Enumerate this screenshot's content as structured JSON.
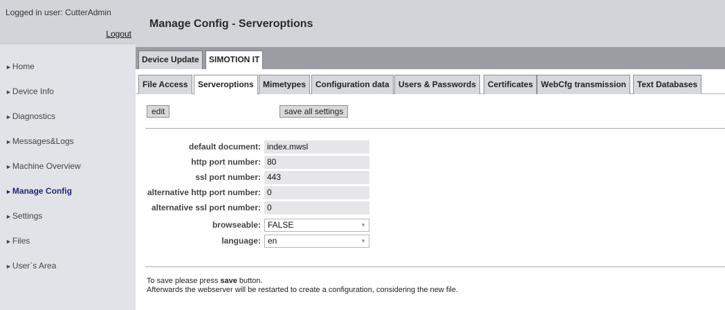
{
  "login": {
    "user_text": "Logged in user: CutterAdmin",
    "logout_label": "Logout"
  },
  "nav": {
    "arrow": "►",
    "items": [
      {
        "label": "Home"
      },
      {
        "label": "Device Info"
      },
      {
        "label": "Diagnostics"
      },
      {
        "label": "Messages&Logs"
      },
      {
        "label": "Machine Overview"
      },
      {
        "label": "Manage Config"
      },
      {
        "label": "Settings"
      },
      {
        "label": "Files"
      },
      {
        "label": "User`s Area"
      }
    ],
    "active": "Manage Config"
  },
  "header": {
    "title": "Manage Config - Serveroptions"
  },
  "top_tabs": [
    {
      "label": "Device Update"
    },
    {
      "label": "SIMOTION IT"
    }
  ],
  "sub_tabs": [
    {
      "label": "File Access"
    },
    {
      "label": "Serveroptions"
    },
    {
      "label": "Mimetypes"
    },
    {
      "label": "Configuration data"
    },
    {
      "label": "Users & Passwords"
    },
    {
      "label": "Certificates"
    },
    {
      "label": "WebCfg transmission"
    },
    {
      "label": "Text Databases"
    }
  ],
  "toolbar": {
    "edit_label": "edit",
    "save_all_label": "save all settings"
  },
  "form": {
    "default_document": {
      "label": "default document:",
      "value": "index.mwsl"
    },
    "http_port": {
      "label": "http port number:",
      "value": "80"
    },
    "ssl_port": {
      "label": "ssl port number:",
      "value": "443"
    },
    "alt_http_port": {
      "label": "alternative http port number:",
      "value": "0"
    },
    "alt_ssl_port": {
      "label": "alternative ssl port number:",
      "value": "0"
    },
    "browseable": {
      "label": "browseable:",
      "value": "FALSE"
    },
    "language": {
      "label": "language:",
      "value": "en"
    }
  },
  "note": {
    "line1_prefix": "To save please press ",
    "line1_bold": "save",
    "line1_suffix": " button.",
    "line2": "Afterwards the webserver will be restarted to create a configuration, considering the new file."
  },
  "icons": {
    "dropdown": "chevron-down-icon",
    "nav_arrow": "triangle-right-icon"
  },
  "colors": {
    "active_nav": "#1c2a6b",
    "tab_bar": "#9c9da3",
    "header_bg": "#d3d4da"
  }
}
